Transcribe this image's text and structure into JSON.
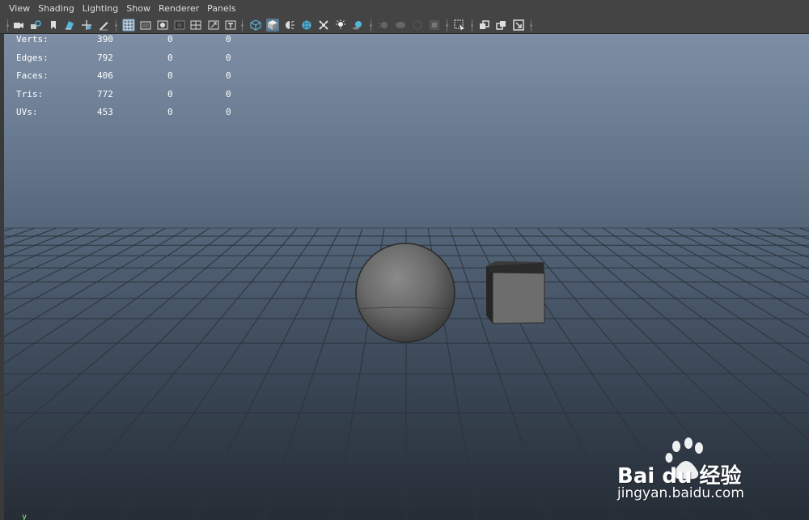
{
  "menu": [
    "View",
    "Shading",
    "Lighting",
    "Show",
    "Renderer",
    "Panels"
  ],
  "toolbar_icons": [
    "camera-icon",
    "camera-attributes-icon",
    "bookmark-icon",
    "image-plane-icon",
    "2d-pan-zoom-icon",
    "grease-pencil-icon",
    "grid-icon",
    "film-gate-icon",
    "resolution-gate-icon",
    "gate-mask-icon",
    "field-chart-icon",
    "safe-action-icon",
    "safe-title-icon",
    "wireframe-icon",
    "smooth-shade-icon",
    "default-lighting-icon",
    "textured-icon",
    "use-all-lights-icon",
    "shadows-icon",
    "screen-space-ao-icon",
    "motion-blur-icon",
    "multisample-aa-icon",
    "depth-of-field-icon",
    "isolate-select-icon",
    "xray-icon",
    "xray-joints-icon",
    "xray-components-icon"
  ],
  "stats": {
    "rows": [
      {
        "label": "Verts:",
        "a": "390",
        "b": "0",
        "c": "0"
      },
      {
        "label": "Edges:",
        "a": "792",
        "b": "0",
        "c": "0"
      },
      {
        "label": "Faces:",
        "a": "406",
        "b": "0",
        "c": "0"
      },
      {
        "label": "Tris:",
        "a": "772",
        "b": "0",
        "c": "0"
      },
      {
        "label": "UVs:",
        "a": "453",
        "b": "0",
        "c": "0"
      }
    ]
  },
  "scene": {
    "objects": [
      "sphere",
      "cube"
    ],
    "grid": true,
    "background_top": "#7e8fa5",
    "background_bottom": "#262d36"
  },
  "axis": {
    "label": "y"
  },
  "watermark": {
    "brand": "Bai du 经验",
    "url": "jingyan.baidu.com"
  },
  "colors": {
    "accent": "#56b6d8",
    "menu_bg": "#444444",
    "text": "#dcdcdc"
  }
}
